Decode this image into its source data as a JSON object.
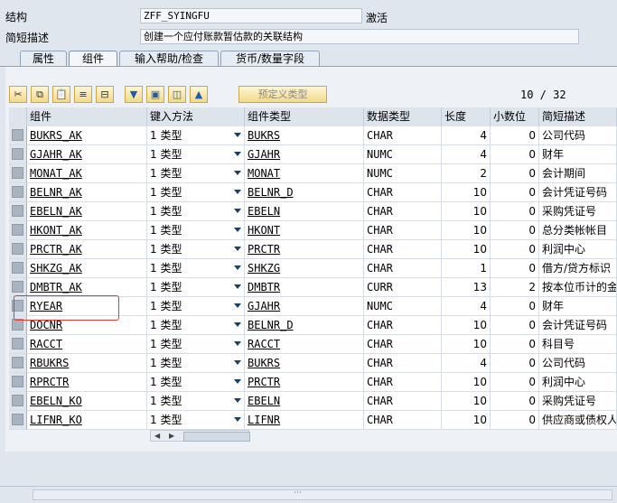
{
  "header": {
    "structure_label": "结构",
    "structure_value": "ZFF_SYINGFU",
    "status": "激活",
    "desc_label": "简短描述",
    "desc_value": "创建一个应付账款暂估款的关联结构"
  },
  "tabs": [
    {
      "label": "属性",
      "active": false
    },
    {
      "label": "组件",
      "active": true
    },
    {
      "label": "输入帮助/检查",
      "active": false
    },
    {
      "label": "货币/数量字段",
      "active": false
    }
  ],
  "toolbar": {
    "predefined_type_label": "预定义类型",
    "pager": "10 / 32",
    "icons": [
      "cut-icon",
      "copy-icon",
      "paste-icon",
      "insert-row-icon",
      "delete-row-icon",
      "sort-down-icon",
      "detail-icon",
      "copy-detail-icon",
      "sort-up-icon"
    ]
  },
  "table": {
    "columns": [
      "组件",
      "键入方法",
      "组件类型",
      "数据类型",
      "长度",
      "小数位",
      "简短描述"
    ],
    "rows": [
      {
        "name": "BUKRS_AK",
        "typing": "1 类型",
        "type": "BUKRS",
        "dtype": "CHAR",
        "len": "4",
        "dec": "0",
        "desc": "公司代码"
      },
      {
        "name": "GJAHR_AK",
        "typing": "1 类型",
        "type": "GJAHR",
        "dtype": "NUMC",
        "len": "4",
        "dec": "0",
        "desc": "财年"
      },
      {
        "name": "MONAT_AK",
        "typing": "1 类型",
        "type": "MONAT",
        "dtype": "NUMC",
        "len": "2",
        "dec": "0",
        "desc": "会计期间"
      },
      {
        "name": "BELNR_AK",
        "typing": "1 类型",
        "type": "BELNR_D",
        "dtype": "CHAR",
        "len": "10",
        "dec": "0",
        "desc": "会计凭证号码"
      },
      {
        "name": "EBELN_AK",
        "typing": "1 类型",
        "type": "EBELN",
        "dtype": "CHAR",
        "len": "10",
        "dec": "0",
        "desc": "采购凭证号"
      },
      {
        "name": "HKONT_AK",
        "typing": "1 类型",
        "type": "HKONT",
        "dtype": "CHAR",
        "len": "10",
        "dec": "0",
        "desc": "总分类帐帐目"
      },
      {
        "name": "PRCTR_AK",
        "typing": "1 类型",
        "type": "PRCTR",
        "dtype": "CHAR",
        "len": "10",
        "dec": "0",
        "desc": "利润中心"
      },
      {
        "name": "SHKZG_AK",
        "typing": "1 类型",
        "type": "SHKZG",
        "dtype": "CHAR",
        "len": "1",
        "dec": "0",
        "desc": "借方/贷方标识"
      },
      {
        "name": "DMBTR_AK",
        "typing": "1 类型",
        "type": "DMBTR",
        "dtype": "CURR",
        "len": "13",
        "dec": "2",
        "desc": "按本位币计的金额"
      },
      {
        "name": "RYEAR",
        "typing": "1 类型",
        "type": "GJAHR",
        "dtype": "NUMC",
        "len": "4",
        "dec": "0",
        "desc": "财年"
      },
      {
        "name": "DOCNR",
        "typing": "1 类型",
        "type": "BELNR_D",
        "dtype": "CHAR",
        "len": "10",
        "dec": "0",
        "desc": "会计凭证号码"
      },
      {
        "name": "RACCT",
        "typing": "1 类型",
        "type": "RACCT",
        "dtype": "CHAR",
        "len": "10",
        "dec": "0",
        "desc": "科目号"
      },
      {
        "name": "RBUKRS",
        "typing": "1 类型",
        "type": "BUKRS",
        "dtype": "CHAR",
        "len": "4",
        "dec": "0",
        "desc": "公司代码"
      },
      {
        "name": "RPRCTR",
        "typing": "1 类型",
        "type": "PRCTR",
        "dtype": "CHAR",
        "len": "10",
        "dec": "0",
        "desc": "利润中心"
      },
      {
        "name": "EBELN_KO",
        "typing": "1 类型",
        "type": "EBELN",
        "dtype": "CHAR",
        "len": "10",
        "dec": "0",
        "desc": "采购凭证号"
      },
      {
        "name": "LIFNR_KO",
        "typing": "1 类型",
        "type": "LIFNR",
        "dtype": "CHAR",
        "len": "10",
        "dec": "0",
        "desc": "供应商或债权人的"
      }
    ]
  },
  "colors": {
    "highlight": "#e53935",
    "accent": "#1d3f66"
  }
}
